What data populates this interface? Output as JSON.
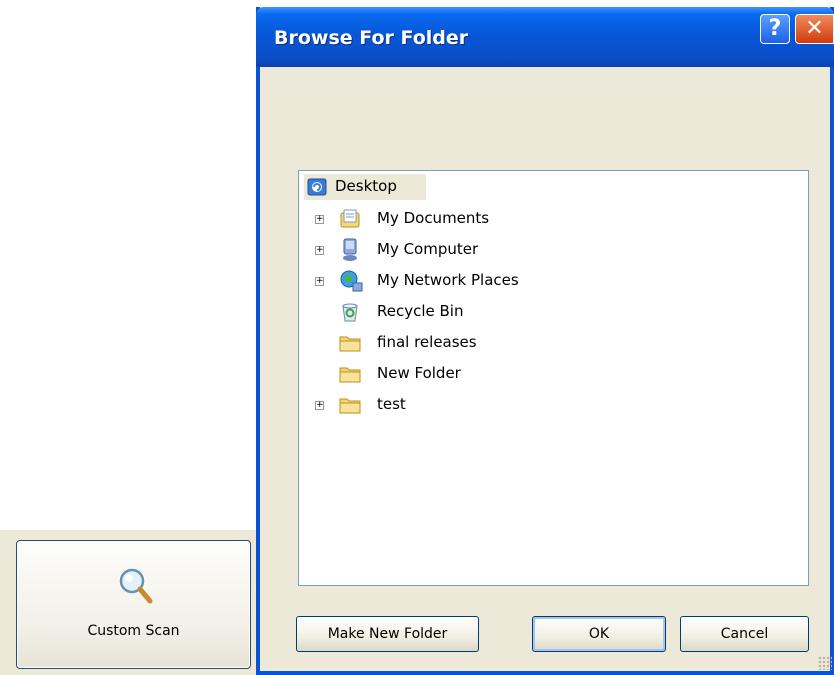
{
  "app": {
    "custom_scan_label": "Custom Scan"
  },
  "dialog": {
    "title": "Browse For Folder",
    "help_label": "?",
    "close_label": "✕",
    "tree": {
      "root": "Desktop",
      "items": [
        {
          "label": "My Documents",
          "icon": "documents-icon",
          "expandable": true
        },
        {
          "label": "My Computer",
          "icon": "computer-icon",
          "expandable": true
        },
        {
          "label": "My Network Places",
          "icon": "network-icon",
          "expandable": true
        },
        {
          "label": "Recycle Bin",
          "icon": "recycle-bin-icon",
          "expandable": false
        },
        {
          "label": "final releases",
          "icon": "folder-icon",
          "expandable": false
        },
        {
          "label": "New Folder",
          "icon": "folder-icon",
          "expandable": false
        },
        {
          "label": "test",
          "icon": "folder-icon",
          "expandable": true
        }
      ]
    },
    "buttons": {
      "make_new_folder": "Make New Folder",
      "ok": "OK",
      "cancel": "Cancel"
    }
  },
  "colors": {
    "titlebar": "#0a53d6",
    "dialog_bg": "#ece9d8",
    "tree_border": "#7f9db9"
  }
}
